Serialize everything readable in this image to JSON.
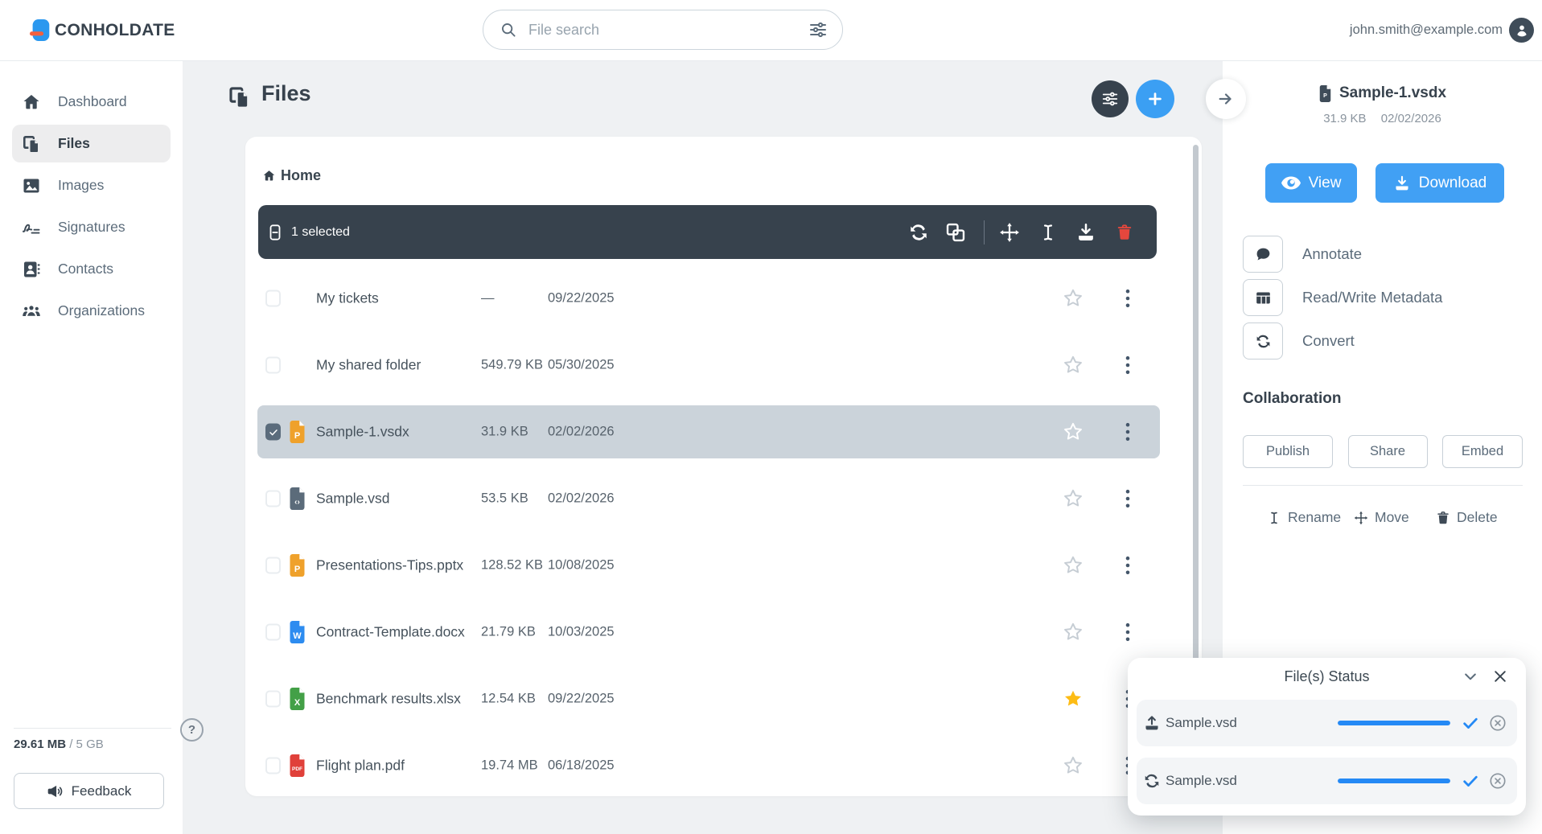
{
  "colors": {
    "accent_blue": "#41a0f4",
    "share_blue": "#2489f5",
    "toolbar_slate": "#37424d",
    "selected_row": "#cbd3da",
    "star_yellow": "#fdbc15",
    "danger_red": "#e5473d"
  },
  "topbar": {
    "brand": "CONHOLDATE",
    "search_placeholder": "File search",
    "user_email": "john.smith@example.com"
  },
  "sidebar": {
    "items": [
      {
        "label": "Dashboard",
        "icon": "home-icon",
        "active": false
      },
      {
        "label": "Files",
        "icon": "files-icon",
        "active": true
      },
      {
        "label": "Images",
        "icon": "image-icon",
        "active": false
      },
      {
        "label": "Signatures",
        "icon": "signature-icon",
        "active": false
      },
      {
        "label": "Contacts",
        "icon": "contacts-icon",
        "active": false
      },
      {
        "label": "Organizations",
        "icon": "organizations-icon",
        "active": false
      }
    ],
    "storage_used": "29.61 MB",
    "storage_total": "/ 5 GB",
    "feedback_label": "Feedback",
    "help_label": "?"
  },
  "main": {
    "title": "Files",
    "breadcrumb": "Home",
    "selection_label": "1 selected",
    "rows": [
      {
        "name": "My tickets",
        "type": "folder",
        "size": "—",
        "date": "09/22/2025",
        "eye": false,
        "doc_slot": "none",
        "share": "gray",
        "star": "outline",
        "selected": false
      },
      {
        "name": "My shared folder",
        "type": "folder",
        "size": "549.79 KB",
        "date": "05/30/2025",
        "eye": false,
        "doc_slot": "none",
        "share": "blue",
        "star": "outline",
        "selected": false
      },
      {
        "name": "Sample-1.vsdx",
        "type": "file",
        "badge": "P",
        "badge_color": "#efa12b",
        "size": "31.9 KB",
        "date": "02/02/2026",
        "eye": true,
        "doc_slot": "doc-white",
        "share": "white",
        "star": "outline",
        "selected": true
      },
      {
        "name": "Sample.vsd",
        "type": "file",
        "badge": "‹›",
        "badge_color": "#5b6b7a",
        "size": "53.5 KB",
        "date": "02/02/2026",
        "eye": true,
        "doc_slot": "doc-gray",
        "share": "gray",
        "star": "outline",
        "selected": false
      },
      {
        "name": "Presentations-Tips.pptx",
        "type": "file",
        "badge": "P",
        "badge_color": "#efa12b",
        "size": "128.52 KB",
        "date": "10/08/2025",
        "eye": true,
        "doc_slot": "doc-gray",
        "share": "gray",
        "star": "outline",
        "selected": false
      },
      {
        "name": "Contract-Template.docx",
        "type": "file",
        "badge": "W",
        "badge_color": "#2d8cf0",
        "size": "21.79 KB",
        "date": "10/03/2025",
        "eye": true,
        "doc_slot": "doc-gray",
        "share": "blue",
        "star": "outline",
        "selected": false
      },
      {
        "name": "Benchmark results.xlsx",
        "type": "file",
        "badge": "X",
        "badge_color": "#43a047",
        "size": "12.54 KB",
        "date": "09/22/2025",
        "eye": true,
        "doc_slot": "doc-blue",
        "share": "gray",
        "star": "filled",
        "selected": false
      },
      {
        "name": "Flight plan.pdf",
        "type": "file",
        "badge": "PDF",
        "badge_color": "#e0403a",
        "size": "19.74 MB",
        "date": "06/18/2025",
        "eye": true,
        "doc_slot": "clock",
        "share": "blue",
        "star": "outline",
        "selected": false
      }
    ]
  },
  "panel": {
    "file_name": "Sample-1.vsdx",
    "file_badge": "P",
    "file_size": "31.9 KB",
    "file_date": "02/02/2026",
    "view_label": "View",
    "download_label": "Download",
    "tools": [
      {
        "label": "Annotate",
        "icon": "comment-icon"
      },
      {
        "label": "Read/Write Metadata",
        "icon": "metadata-table-icon"
      },
      {
        "label": "Convert",
        "icon": "convert-icon"
      }
    ],
    "collaboration_title": "Collaboration",
    "collab_buttons": [
      {
        "label": "Publish"
      },
      {
        "label": "Share"
      },
      {
        "label": "Embed"
      }
    ],
    "file_ops": [
      {
        "label": "Rename",
        "icon": "rename-icon"
      },
      {
        "label": "Move",
        "icon": "move-icon"
      },
      {
        "label": "Delete",
        "icon": "trash-icon"
      }
    ]
  },
  "status_popup": {
    "title": "File(s) Status",
    "items": [
      {
        "name": "Sample.vsd",
        "icon": "upload-icon",
        "progress": 100,
        "done": true
      },
      {
        "name": "Sample.vsd",
        "icon": "convert-icon",
        "progress": 100,
        "done": true
      }
    ]
  }
}
